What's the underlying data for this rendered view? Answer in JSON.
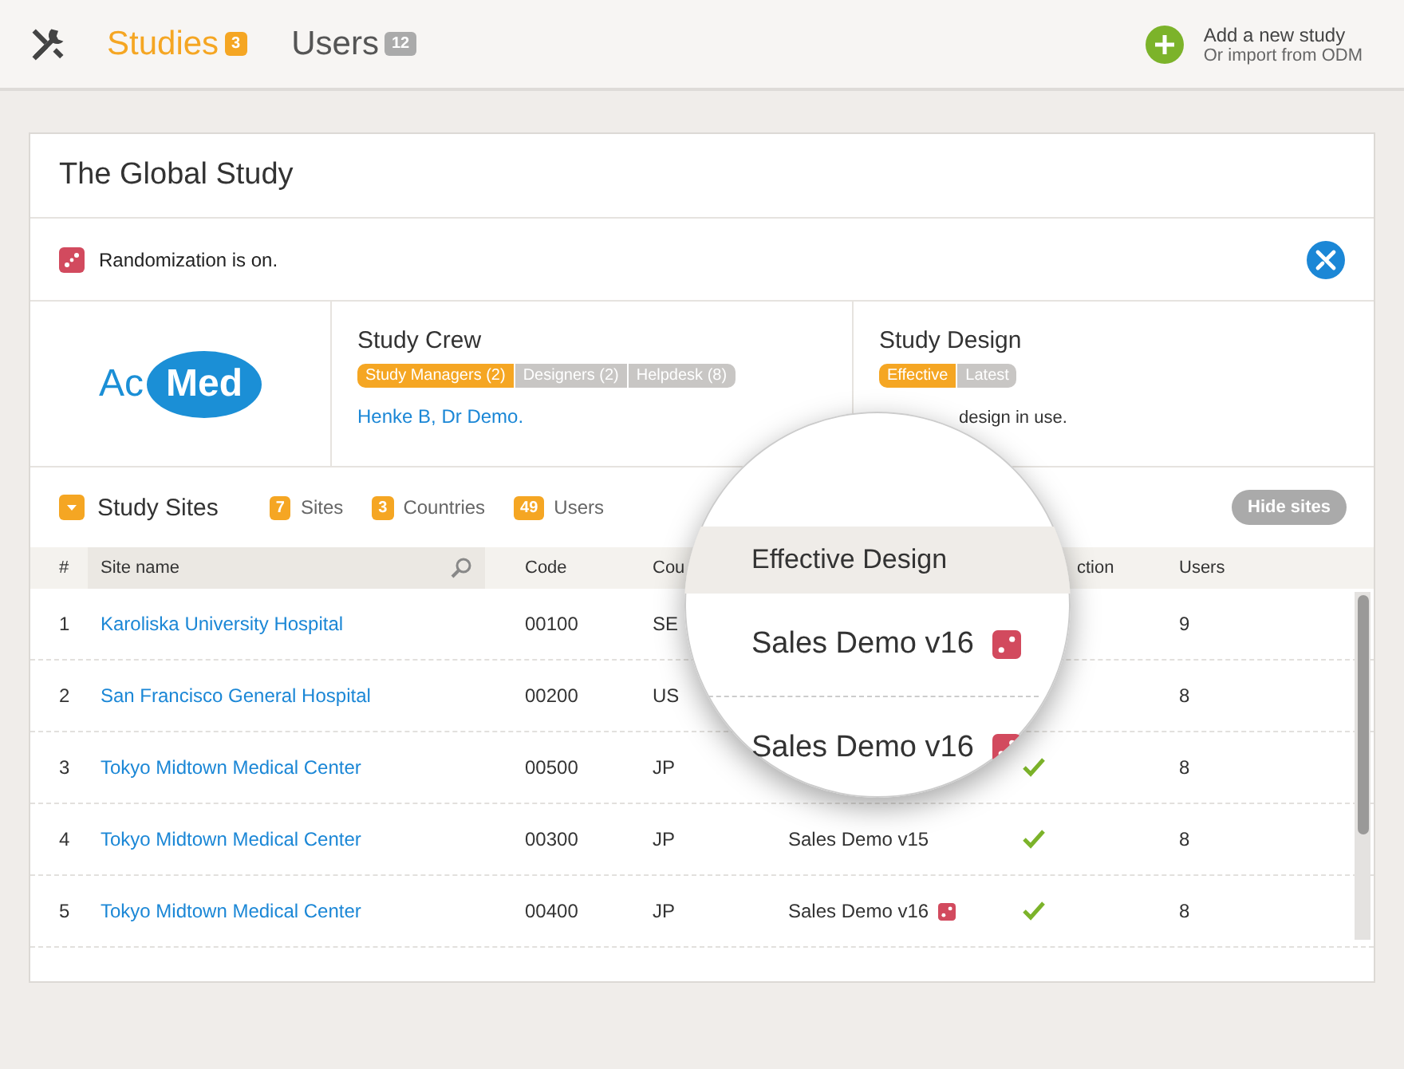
{
  "nav": {
    "tabs": [
      {
        "label": "Studies",
        "count": "3",
        "selected": true
      },
      {
        "label": "Users",
        "count": "12",
        "selected": false
      }
    ],
    "add": {
      "title": "Add a new study",
      "subtitle": "Or import from ODM"
    }
  },
  "study": {
    "title": "The Global Study",
    "randomization": "Randomization is on.",
    "logo": {
      "left": "Ac",
      "right": "Med"
    },
    "crew": {
      "title": "Study Crew",
      "tags": [
        {
          "label": "Study Managers (2)",
          "selected": true
        },
        {
          "label": "Designers (2)",
          "selected": false
        },
        {
          "label": "Helpdesk (8)",
          "selected": false
        }
      ],
      "members": "Henke B, Dr Demo."
    },
    "design": {
      "title": "Study Design",
      "tags": [
        {
          "label": "Effective",
          "selected": true
        },
        {
          "label": "Latest",
          "selected": false
        }
      ],
      "note": "design in use."
    }
  },
  "sites": {
    "title": "Study Sites",
    "stats": [
      {
        "count": "7",
        "label": "Sites"
      },
      {
        "count": "3",
        "label": "Countries"
      },
      {
        "count": "49",
        "label": "Users"
      }
    ],
    "hide_button": "Hide sites",
    "columns": [
      "#",
      "Site name",
      "Code",
      "Cou",
      "",
      "ction",
      "Users"
    ],
    "rows": [
      {
        "num": "1",
        "site": "Karoliska University Hospital",
        "code": "00100",
        "country": "SE",
        "users": "9"
      },
      {
        "num": "2",
        "site": "San Francisco General Hospital",
        "code": "00200",
        "country": "US",
        "users": "8"
      },
      {
        "num": "3",
        "site": "Tokyo Midtown Medical Center",
        "code": "00500",
        "country": "JP",
        "checked": true,
        "users": "8"
      },
      {
        "num": "4",
        "site": "Tokyo Midtown Medical Center",
        "code": "00300",
        "country": "JP",
        "design": "Sales Demo v15",
        "randomized": false,
        "checked": true,
        "users": "8"
      },
      {
        "num": "5",
        "site": "Tokyo Midtown Medical Center",
        "code": "00400",
        "country": "JP",
        "design": "Sales Demo v16",
        "randomized": true,
        "checked": true,
        "users": "8"
      }
    ]
  },
  "magnifier": {
    "header": "Effective Design",
    "items": [
      {
        "text": "Sales Demo v16",
        "randomized": true
      },
      {
        "text": "Sales Demo v16",
        "randomized": true
      }
    ]
  }
}
